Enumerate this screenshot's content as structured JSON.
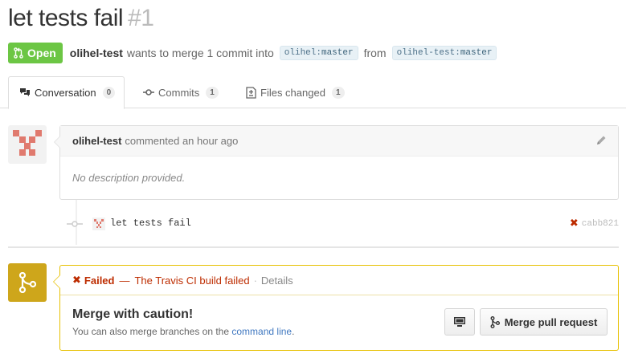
{
  "pr": {
    "title": "let tests fail",
    "number": "#1",
    "state": "Open",
    "author": "olihel-test",
    "merge_text": "wants to merge 1 commit into",
    "base_owner": "olihel:",
    "base_branch": "master",
    "from_text": "from",
    "head_owner": "olihel-test:",
    "head_branch": "master"
  },
  "tabs": [
    {
      "label": "Conversation",
      "count": "0",
      "icon": "comment-discussion-icon",
      "active": true
    },
    {
      "label": "Commits",
      "count": "1",
      "icon": "git-commit-icon"
    },
    {
      "label": "Files changed",
      "count": "1",
      "icon": "diff-icon"
    }
  ],
  "comment": {
    "author": "olihel-test",
    "action": "commented an hour ago",
    "body": "No description provided."
  },
  "commit": {
    "message": "let tests fail",
    "sha": "cabb821",
    "status": "failed"
  },
  "merge": {
    "status_label": "Failed",
    "status_dash": "—",
    "status_desc": "The Travis CI build failed",
    "status_dot": "·",
    "details_label": "Details",
    "heading": "Merge with caution!",
    "sub_text": "You can also merge branches on the",
    "sub_link": "command line",
    "sub_end": ".",
    "merge_button": "Merge pull request"
  },
  "colors": {
    "open": "#6cc644",
    "fail": "#bd2c00",
    "warning": "#cea61b",
    "link": "#4078c0"
  }
}
